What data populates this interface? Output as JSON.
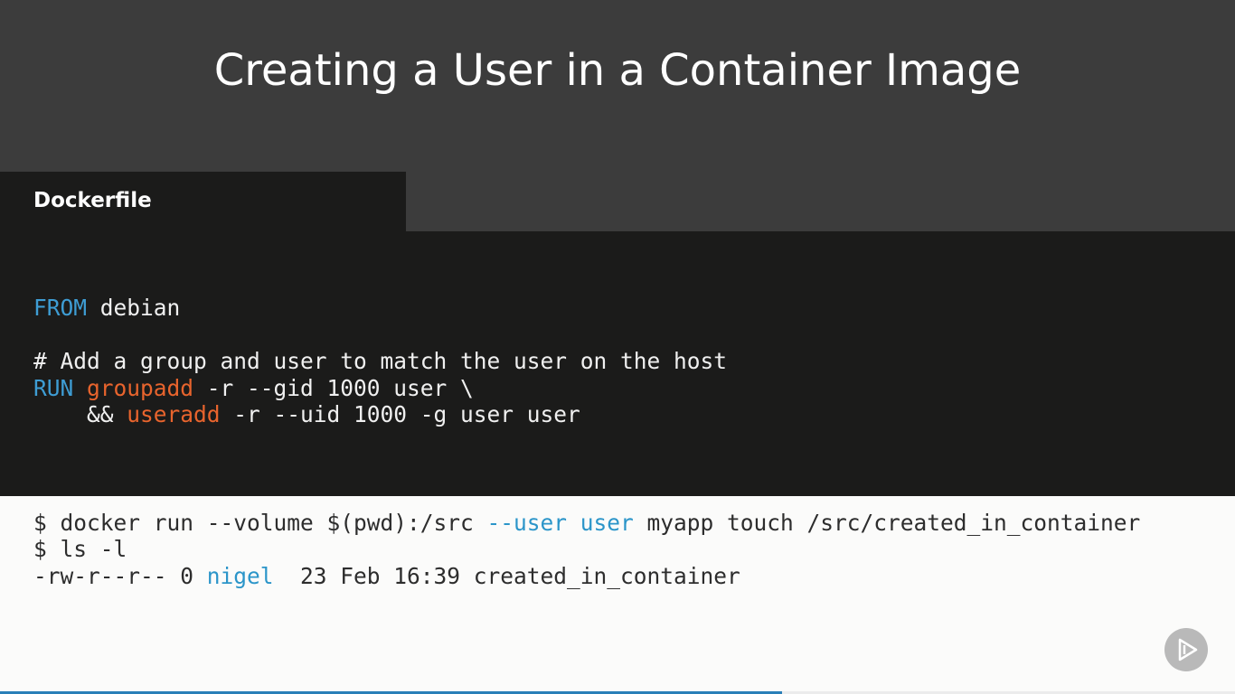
{
  "slide": {
    "title": "Creating a User in a Container Image",
    "tab_label": "Dockerfile"
  },
  "dockerfile": {
    "from_kw": "FROM",
    "from_rest": " debian",
    "comment": "# Add a group and user to match the user on the host",
    "run_kw": "RUN",
    "groupadd": "groupadd",
    "groupadd_rest": " -r --gid 1000 user \\",
    "and_prefix": "    && ",
    "useradd": "useradd",
    "useradd_rest": " -r --uid 1000 -g user user"
  },
  "terminal": {
    "line1_a": "$ docker run --volume $(pwd):/src ",
    "line1_user_flag": "--user user",
    "line1_b": " myapp touch /src/created_in_container",
    "line2": "$ ls -l",
    "line3_a": "-rw-r--r-- 0 ",
    "line3_owner": "nigel",
    "line3_b": "  23 Feb 16:39 created_in_container"
  },
  "player": {
    "progress": 0.633,
    "play_icon": "play-icon",
    "colors": {
      "progress": "#2a7fb8",
      "keyword": "#3e9dd4",
      "command": "#e8642d"
    }
  }
}
